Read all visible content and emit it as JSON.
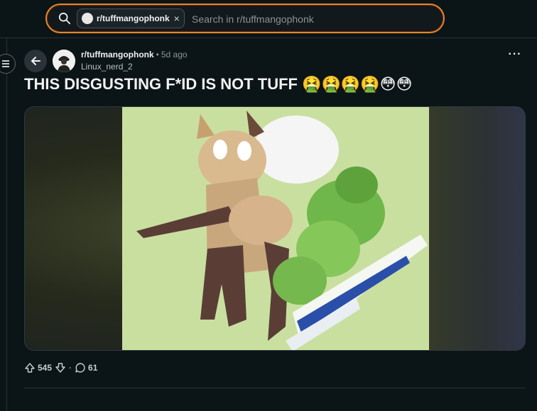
{
  "search": {
    "chip_label": "r/tuffmangophonk",
    "placeholder": "Search in r/tuffmangophonk",
    "value": ""
  },
  "post": {
    "subreddit": "r/tuffmangophonk",
    "separator": "•",
    "time": "5d ago",
    "author": "Linux_nerd_2",
    "title": "THIS DISGUSTING F*ID IS NOT TUFF 🤮🤮🤮🤮😳😳",
    "more": "···"
  },
  "actions": {
    "upvotes": "545",
    "separator": "·",
    "comments": "61"
  },
  "colors": {
    "background": "#0b1416",
    "search_border": "#e0882a",
    "media_green": "#c9dfa0"
  }
}
